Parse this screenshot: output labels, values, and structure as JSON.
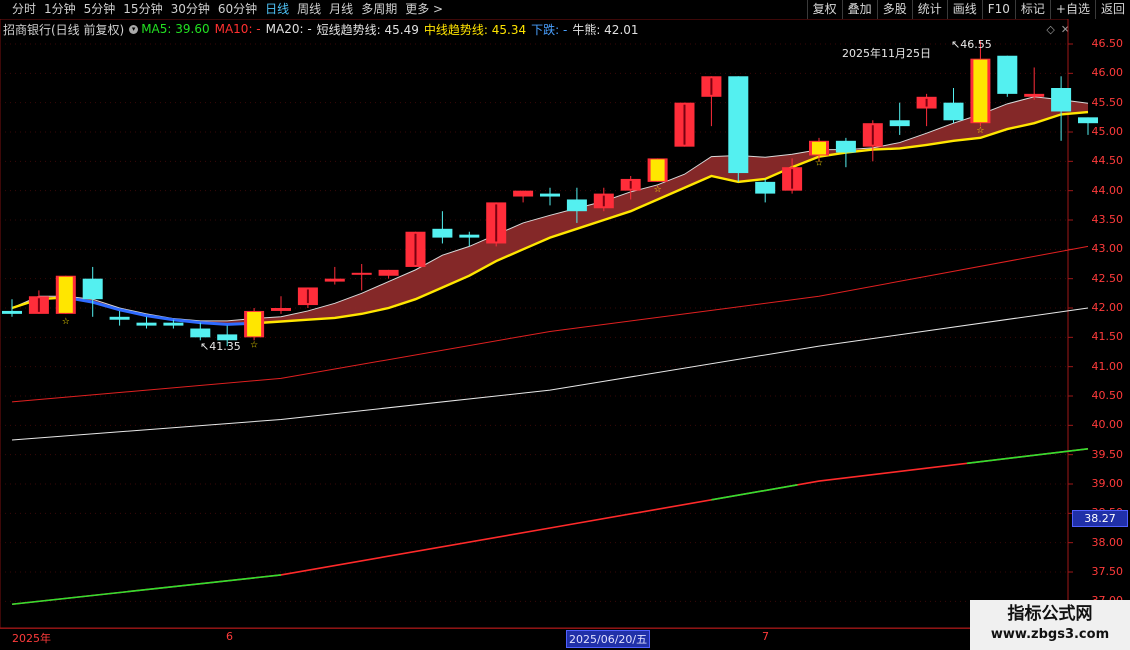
{
  "toolbar": {
    "tabs": [
      "分时",
      "1分钟",
      "5分钟",
      "15分钟",
      "30分钟",
      "60分钟",
      "日线",
      "周线",
      "月线",
      "多周期",
      "更多 >"
    ],
    "active_tab": "日线",
    "buttons": [
      "复权",
      "叠加",
      "多股",
      "统计",
      "画线",
      "F10",
      "标记",
      "+自选",
      "返回"
    ]
  },
  "legend": {
    "stock": "招商银行(日线 前复权)",
    "ma5": "MA5: 39.60",
    "ma10": "MA10: -",
    "ma20": "MA20: -",
    "short_trend": "短线趋势线: 45.49",
    "mid_trend": "中线趋势线: 45.34",
    "down": "下跌: -",
    "bear": "牛熊: 42.01"
  },
  "axis": {
    "y_labels": [
      "46.50",
      "46.00",
      "45.50",
      "45.00",
      "44.50",
      "44.00",
      "43.50",
      "43.00",
      "42.50",
      "42.00",
      "41.50",
      "41.00",
      "40.50",
      "40.00",
      "39.50",
      "39.00",
      "38.50",
      "38.00",
      "37.50",
      "37.00"
    ],
    "current_price": "38.27",
    "x_labels": [
      "2025年",
      "6",
      "7"
    ],
    "cursor_date": "2025/06/20/五"
  },
  "annotations": {
    "date_label": "2025年11月25日",
    "high_mark": "46.55",
    "low_mark": "41.35"
  },
  "watermark": {
    "line1": "指标公式网",
    "line2": "www.zbgs3.com"
  },
  "colors": {
    "up": "#ff2d3a",
    "down": "#54f0f0",
    "signal": "#ffe600",
    "trend_fill": "#8b2a2a"
  },
  "chart_data": {
    "type": "candlestick",
    "candles": [
      {
        "o": 41.95,
        "c": 41.9,
        "h": 42.15,
        "l": 41.85
      },
      {
        "o": 41.9,
        "c": 42.2,
        "h": 42.3,
        "l": 41.9
      },
      {
        "o": 41.9,
        "c": 42.55,
        "h": 42.55,
        "l": 41.9,
        "sig": true
      },
      {
        "o": 42.5,
        "c": 42.15,
        "h": 42.7,
        "l": 41.85
      },
      {
        "o": 41.85,
        "c": 41.8,
        "h": 41.95,
        "l": 41.7
      },
      {
        "o": 41.75,
        "c": 41.7,
        "h": 41.85,
        "l": 41.65
      },
      {
        "o": 41.75,
        "c": 41.7,
        "h": 41.8,
        "l": 41.65
      },
      {
        "o": 41.65,
        "c": 41.5,
        "h": 41.75,
        "l": 41.45
      },
      {
        "o": 41.55,
        "c": 41.45,
        "h": 41.7,
        "l": 41.35
      },
      {
        "o": 41.5,
        "c": 41.95,
        "h": 42.0,
        "l": 41.45,
        "sig": true
      },
      {
        "o": 41.95,
        "c": 42.0,
        "h": 42.2,
        "l": 41.9
      },
      {
        "o": 42.05,
        "c": 42.35,
        "h": 42.35,
        "l": 42.0
      },
      {
        "o": 42.45,
        "c": 42.5,
        "h": 42.7,
        "l": 42.4
      },
      {
        "o": 42.6,
        "c": 42.6,
        "h": 42.75,
        "l": 42.3
      },
      {
        "o": 42.55,
        "c": 42.65,
        "h": 42.65,
        "l": 42.5
      },
      {
        "o": 42.7,
        "c": 43.3,
        "h": 43.3,
        "l": 42.7
      },
      {
        "o": 43.35,
        "c": 43.2,
        "h": 43.65,
        "l": 43.1
      },
      {
        "o": 43.25,
        "c": 43.2,
        "h": 43.3,
        "l": 43.05
      },
      {
        "o": 43.1,
        "c": 43.8,
        "h": 43.8,
        "l": 43.05
      },
      {
        "o": 43.9,
        "c": 44.0,
        "h": 44.0,
        "l": 43.8
      },
      {
        "o": 43.95,
        "c": 43.9,
        "h": 44.05,
        "l": 43.75
      },
      {
        "o": 43.85,
        "c": 43.65,
        "h": 44.05,
        "l": 43.45
      },
      {
        "o": 43.7,
        "c": 43.95,
        "h": 44.05,
        "l": 43.65
      },
      {
        "o": 44.0,
        "c": 44.2,
        "h": 44.25,
        "l": 43.85
      },
      {
        "o": 44.15,
        "c": 44.55,
        "h": 44.55,
        "l": 44.15,
        "sig": true
      },
      {
        "o": 44.75,
        "c": 45.5,
        "h": 45.5,
        "l": 44.75
      },
      {
        "o": 45.6,
        "c": 45.95,
        "h": 45.95,
        "l": 45.1
      },
      {
        "o": 45.95,
        "c": 44.3,
        "h": 45.95,
        "l": 44.15
      },
      {
        "o": 44.15,
        "c": 43.95,
        "h": 44.2,
        "l": 43.8
      },
      {
        "o": 44.0,
        "c": 44.4,
        "h": 44.55,
        "l": 43.95
      },
      {
        "o": 44.6,
        "c": 44.85,
        "h": 44.9,
        "l": 44.5,
        "sig": true
      },
      {
        "o": 44.85,
        "c": 44.65,
        "h": 44.9,
        "l": 44.4
      },
      {
        "o": 44.75,
        "c": 45.15,
        "h": 45.2,
        "l": 44.5
      },
      {
        "o": 45.2,
        "c": 45.1,
        "h": 45.5,
        "l": 44.95
      },
      {
        "o": 45.4,
        "c": 45.6,
        "h": 45.65,
        "l": 45.1
      },
      {
        "o": 45.5,
        "c": 45.2,
        "h": 45.75,
        "l": 45.15
      },
      {
        "o": 45.15,
        "c": 46.25,
        "h": 46.55,
        "l": 45.1,
        "sig": true
      },
      {
        "o": 46.3,
        "c": 45.65,
        "h": 46.3,
        "l": 45.6
      },
      {
        "o": 45.6,
        "c": 45.65,
        "h": 46.1,
        "l": 45.55
      },
      {
        "o": 45.75,
        "c": 45.35,
        "h": 45.95,
        "l": 44.85
      },
      {
        "o": 45.25,
        "c": 45.15,
        "h": 45.25,
        "l": 44.95
      }
    ],
    "short_trend": [
      42.0,
      42.2,
      42.2,
      42.15,
      42.0,
      41.9,
      41.82,
      41.78,
      41.78,
      41.82,
      41.85,
      41.95,
      42.08,
      42.25,
      42.45,
      42.65,
      42.9,
      43.05,
      43.25,
      43.45,
      43.58,
      43.7,
      43.82,
      43.98,
      44.1,
      44.28,
      44.58,
      44.6,
      44.57,
      44.62,
      44.7,
      44.7,
      44.73,
      44.82,
      44.98,
      45.15,
      45.3,
      45.48,
      45.6,
      45.55,
      45.49
    ],
    "mid_trend": [
      42.0,
      42.15,
      42.18,
      42.1,
      41.97,
      41.87,
      41.8,
      41.75,
      41.72,
      41.74,
      41.77,
      41.8,
      41.83,
      41.9,
      42.0,
      42.15,
      42.35,
      42.55,
      42.8,
      43.0,
      43.2,
      43.35,
      43.5,
      43.65,
      43.85,
      44.05,
      44.25,
      44.15,
      44.2,
      44.4,
      44.58,
      44.65,
      44.7,
      44.72,
      44.78,
      44.85,
      44.9,
      45.05,
      45.15,
      45.3,
      45.34
    ],
    "bear_line": {
      "x": [
        0,
        10,
        20,
        30,
        40
      ],
      "y": [
        40.4,
        40.8,
        41.6,
        42.2,
        43.05
      ]
    },
    "white_line": {
      "x": [
        0,
        10,
        20,
        30,
        40
      ],
      "y": [
        39.75,
        40.1,
        40.6,
        41.35,
        42.0
      ]
    },
    "bottom_line": {
      "x": [
        0,
        10,
        20,
        30,
        40
      ],
      "y": [
        36.95,
        37.45,
        38.25,
        39.05,
        39.6
      ]
    },
    "ylim": [
      36.8,
      46.7
    ]
  }
}
